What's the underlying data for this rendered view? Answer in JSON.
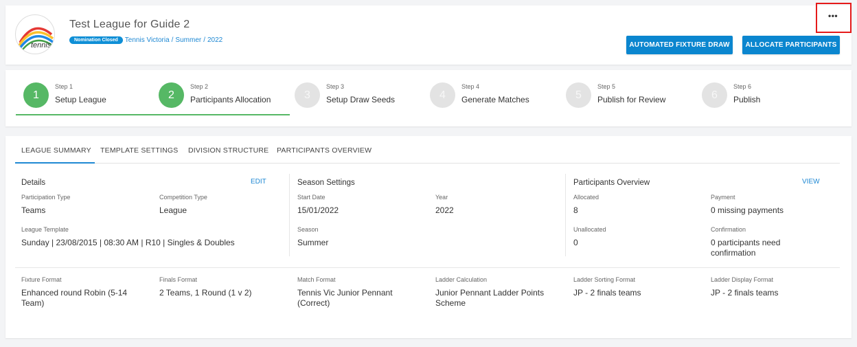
{
  "header": {
    "title": "Test League for Guide 2",
    "logo_text": "tennis",
    "badge": "Nomination Closed",
    "breadcrumb": [
      "Tennis Victoria",
      "Summer",
      "2022"
    ],
    "more_icon": "•••",
    "buttons": {
      "automated_fixture_draw": "AUTOMATED FIXTURE DRAW",
      "allocate_participants": "ALLOCATE PARTICIPANTS"
    }
  },
  "steps": [
    {
      "num": "1",
      "step": "Step 1",
      "label": "Setup League",
      "status": "complete"
    },
    {
      "num": "2",
      "step": "Step 2",
      "label": "Participants Allocation",
      "status": "complete"
    },
    {
      "num": "3",
      "step": "Step 3",
      "label": "Setup Draw Seeds",
      "status": "pending"
    },
    {
      "num": "4",
      "step": "Step 4",
      "label": "Generate Matches",
      "status": "pending"
    },
    {
      "num": "5",
      "step": "Step 5",
      "label": "Publish for Review",
      "status": "pending"
    },
    {
      "num": "6",
      "step": "Step 6",
      "label": "Publish",
      "status": "pending"
    }
  ],
  "tabs": [
    "LEAGUE SUMMARY",
    "TEMPLATE SETTINGS",
    "DIVISION STRUCTURE",
    "PARTICIPANTS OVERVIEW"
  ],
  "details": {
    "title": "Details",
    "edit": "EDIT",
    "participation_type_label": "Participation Type",
    "participation_type": "Teams",
    "competition_type_label": "Competition Type",
    "competition_type": "League",
    "league_template_label": "League Template",
    "league_template": "Sunday | 23/08/2015 | 08:30 AM | R10 | Singles & Doubles"
  },
  "season": {
    "title": "Season Settings",
    "start_date_label": "Start Date",
    "start_date": "15/01/2022",
    "year_label": "Year",
    "year": "2022",
    "season_label": "Season",
    "season": "Summer"
  },
  "participants": {
    "title": "Participants Overview",
    "view": "VIEW",
    "allocated_label": "Allocated",
    "allocated": "8",
    "payment_label": "Payment",
    "payment": "0 missing payments",
    "unallocated_label": "Unallocated",
    "unallocated": "0",
    "confirmation_label": "Confirmation",
    "confirmation": "0 participants need confirmation"
  },
  "formats": {
    "fixture_format_label": "Fixture Format",
    "fixture_format": "Enhanced round Robin (5-14 Team)",
    "finals_format_label": "Finals Format",
    "finals_format": "2 Teams, 1 Round (1 v 2)",
    "match_format_label": "Match Format",
    "match_format": "Tennis Vic Junior Pennant (Correct)",
    "ladder_calculation_label": "Ladder Calculation",
    "ladder_calculation": "Junior Pennant Ladder Points Scheme",
    "ladder_sorting_label": "Ladder Sorting Format",
    "ladder_sorting": "JP - 2 finals teams",
    "ladder_display_label": "Ladder Display Format",
    "ladder_display": "JP - 2 finals teams"
  },
  "colors": {
    "primary": "#0b86cf",
    "link": "#1e88d3",
    "step_complete": "#56b865",
    "step_pending": "#e3e3e3",
    "highlight": "#e51a1a"
  }
}
